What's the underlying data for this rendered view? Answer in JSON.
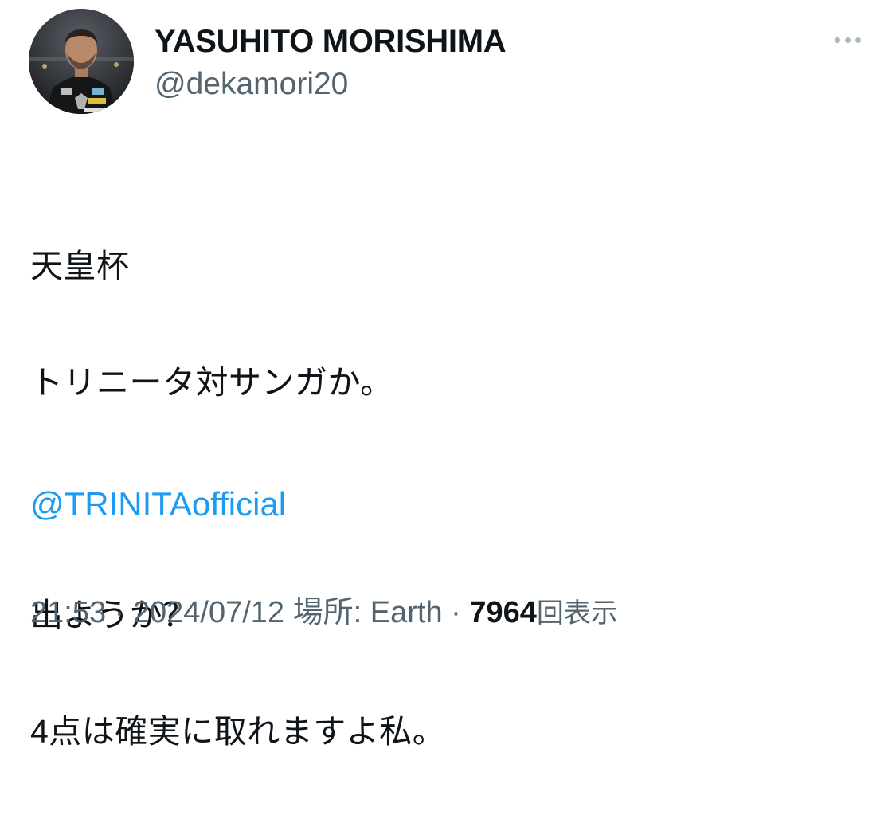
{
  "author": {
    "name": "YASUHITO MORISHIMA",
    "handle": "@dekamori20"
  },
  "tweet": {
    "lines": [
      "天皇杯",
      "トリニータ対サンガか。",
      "",
      "出ようか？",
      "4点は確実に取れますよ私。"
    ],
    "mention": "@TRINITAofficial"
  },
  "meta": {
    "time": "21:53",
    "separator": "·",
    "date": "2024/07/12",
    "location_label": "場所:",
    "location": "Earth",
    "views_count": "7964",
    "views_label": "回表示"
  },
  "icons": {
    "more": "more-horizontal-icon"
  },
  "colors": {
    "text": "#0f1419",
    "secondary": "#536471",
    "link": "#1d9bf0",
    "more_dots": "#aab8c2"
  }
}
